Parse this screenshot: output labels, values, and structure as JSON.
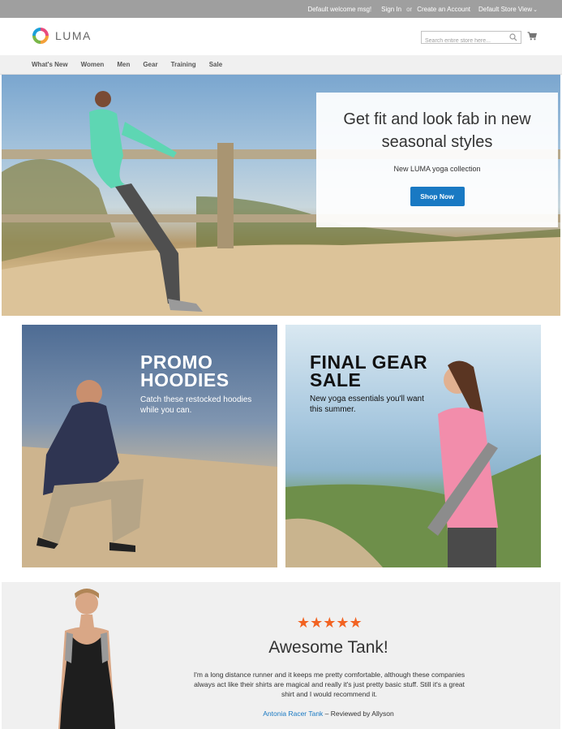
{
  "topbar": {
    "welcome": "Default welcome msg!",
    "sign_in": "Sign In",
    "or": "or",
    "create_account": "Create an Account",
    "store_view": "Default Store View"
  },
  "header": {
    "logo_text": "LUMA",
    "search_placeholder": "Search entire store here...",
    "icons": [
      "search-icon",
      "cart-icon"
    ]
  },
  "nav": {
    "items": [
      "What's New",
      "Women",
      "Men",
      "Gear",
      "Training",
      "Sale"
    ]
  },
  "hero": {
    "headline": "Get fit and look fab in new seasonal styles",
    "subtext": "New LUMA yoga collection",
    "button": "Shop Now",
    "button_color": "#1979c3"
  },
  "promos": [
    {
      "title": "PROMO HOODIES",
      "subtitle": "Catch these restocked hoodies while you can."
    },
    {
      "title": "FINAL GEAR SALE",
      "subtitle": "New yoga essentials you'll want this summer."
    }
  ],
  "testimonial": {
    "rating": 5,
    "stars": "★★★★★",
    "title": "Awesome Tank!",
    "quote": "I'm a long distance runner and it keeps me pretty comfortable, although these companies always act like their shirts are magical and really it's just pretty basic stuff. Still it's a great shirt and I would recommend it.",
    "product_link": "Antonia Racer Tank",
    "reviewed_by": " – Reviewed by Allyson",
    "star_color": "#f26322"
  }
}
